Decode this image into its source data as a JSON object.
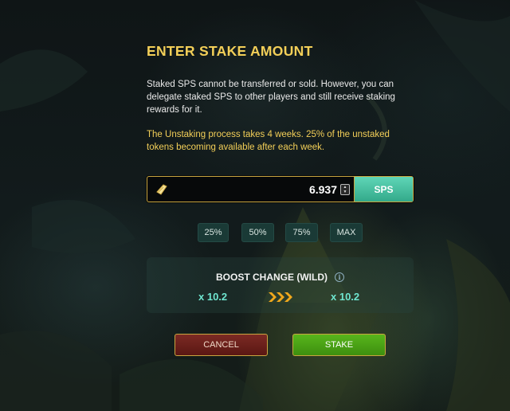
{
  "dialog": {
    "title": "ENTER STAKE AMOUNT",
    "description": "Staked SPS cannot be transferred or sold. However, you can delegate staked SPS to other players and still receive staking rewards for it.",
    "unstake_note": "The Unstaking process takes 4 weeks. 25% of the unstaked tokens becoming available after each week."
  },
  "stake_input": {
    "value": "6.937",
    "currency": "SPS",
    "token_icon": "sps-token-icon"
  },
  "percent_buttons": [
    "25%",
    "50%",
    "75%",
    "MAX"
  ],
  "boost": {
    "label": "BOOST CHANGE (WILD)",
    "from": "x 10.2",
    "to": "x 10.2",
    "info_icon": "info-icon"
  },
  "actions": {
    "cancel": "CANCEL",
    "stake": "STAKE"
  },
  "colors": {
    "title": "#f3cf58",
    "accent_teal": "#6fe5cf",
    "currency_bg": "#4fc4a5",
    "cancel_bg": "#6b211c",
    "stake_bg": "#4ca316",
    "border_gold": "#c9a53f"
  }
}
